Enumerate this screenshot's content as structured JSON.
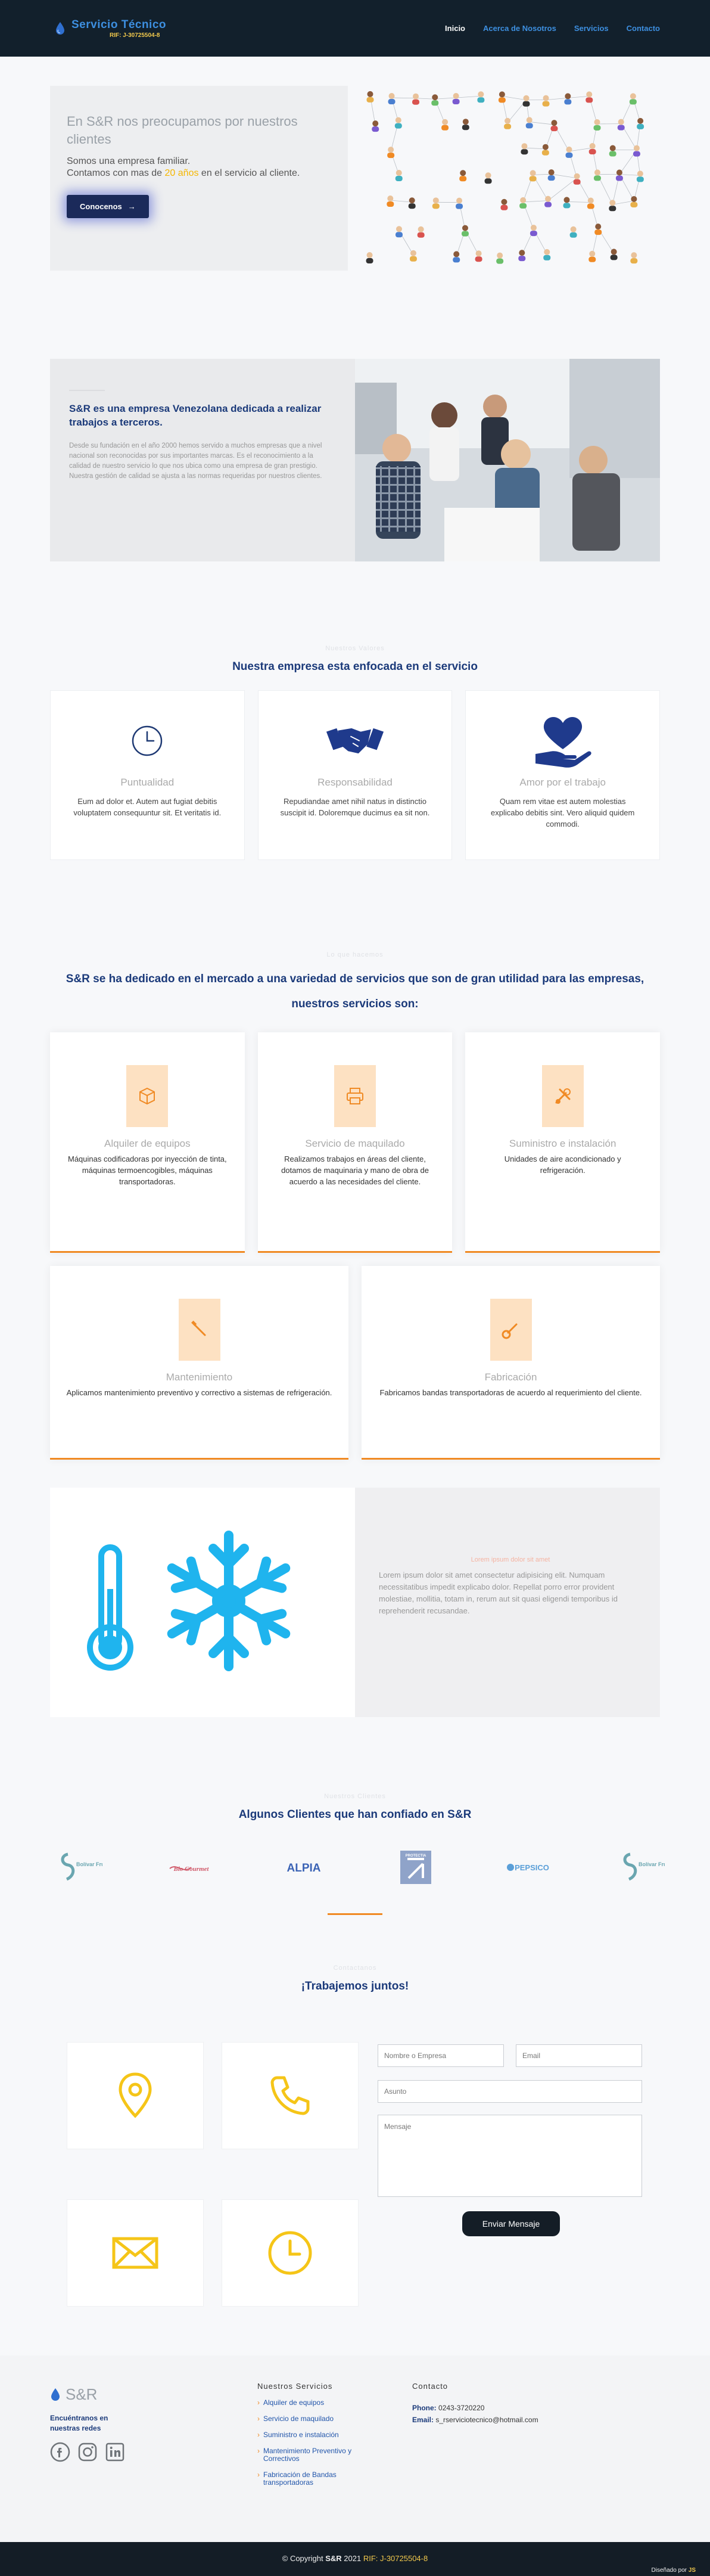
{
  "header": {
    "brand": "Servicio Técnico",
    "rif": "RIF: J-30725504-8",
    "nav": [
      "Inicio",
      "Acerca de Nosotros",
      "Servicios",
      "Contacto"
    ]
  },
  "hero": {
    "title": "En S&R nos preocupamos por nuestros clientes",
    "text_1": "Somos una empresa familiar.",
    "text_2": "Contamos con mas de",
    "highlight": "20 años",
    "text_3": "en el servicio al cliente.",
    "button": "Conocenos"
  },
  "about": {
    "title": "S&R es una empresa Venezolana dedicada a realizar trabajos a terceros.",
    "text": "Desde su fundación en el año 2000 hemos servido a muchos empresas que a nivel nacional son reconocidas por sus importantes marcas. Es el reconocimiento a la calidad de nuestro servicio lo que nos ubica como una empresa de gran prestigio. Nuestra gestión de calidad se ajusta a las normas requeridas por nuestros clientes."
  },
  "values": {
    "label": "Nuestros Valores",
    "title": "Nuestra empresa esta enfocada en el servicio",
    "cards": [
      {
        "title": "Puntualidad",
        "text": "Eum ad dolor et. Autem aut fugiat debitis voluptatem consequuntur sit. Et veritatis id."
      },
      {
        "title": "Responsabilidad",
        "text": "Repudiandae amet nihil natus in distinctio suscipit id. Doloremque ducimus ea sit non."
      },
      {
        "title": "Amor por el trabajo",
        "text": "Quam rem vitae est autem molestias explicabo debitis sint. Vero aliquid quidem commodi."
      }
    ]
  },
  "services": {
    "label": "Lo que hacemos",
    "title": "S&R se ha dedicado en el mercado a una variedad de servicios que son de gran utilidad para las empresas, nuestros servicios son:",
    "cards": [
      {
        "title": "Alquiler de equipos",
        "text": "Máquinas codificadoras por inyección de tinta, máquinas termoencogibles, máquinas transportadoras."
      },
      {
        "title": "Servicio de maquilado",
        "text": "Realizamos trabajos en áreas del cliente, dotamos de maquinaria y mano de obra de acuerdo a las necesidades del cliente."
      },
      {
        "title": "Suministro e instalación",
        "text": "Unidades de aire acondicionado y refrigeración."
      },
      {
        "title": "Mantenimiento",
        "text": "Aplicamos mantenimiento preventivo y correctivo a sistemas de refrigeración."
      },
      {
        "title": "Fabricación",
        "text": "Fabricamos bandas transportadoras de acuerdo al requerimiento del cliente."
      }
    ]
  },
  "refrigeration": {
    "label": "Lorem ipsum dolor sit amet",
    "text": "Lorem ipsum dolor sit amet consectetur adipisicing elit. Numquam necessitatibus impedit explicabo dolor. Repellat porro error provident molestiae, mollitia, totam in, rerum aut sit quasi eligendi temporibus id reprehenderit recusandae."
  },
  "clients": {
    "label": "Nuestros Clientes",
    "title": "Algunos Clientes que han confiado en S&R",
    "logos": [
      {
        "name": "Bolívar Frutas",
        "color": "#6aa6b0"
      },
      {
        "name": "Bio Gourmet",
        "color": "#d05a6a"
      },
      {
        "name": "ALPIA",
        "color": "#3b63b5"
      },
      {
        "name": "PROTECTIA",
        "color": "#8fa3c9"
      },
      {
        "name": "PEPSICO",
        "color": "#5a9fd8"
      },
      {
        "name": "Bolívar Frutas",
        "color": "#6aa6b0"
      }
    ]
  },
  "contact": {
    "label": "Contactanos",
    "title": "¡Trabajemos juntos!",
    "placeholders": {
      "name": "Nombre o Empresa",
      "email": "Email",
      "subject": "Asunto",
      "message": "Mensaje"
    },
    "submit": "Enviar Mensaje"
  },
  "footer": {
    "brand": "S&R",
    "social_text": "Encuéntranos en nuestras redes",
    "services_head": "Nuestros Servicios",
    "services": [
      "Alquiler de equipos",
      "Servicio de maquilado",
      "Suministro e instalación",
      "Mantenimiento Preventivo y Correctivos",
      "Fabricación de Bandas transportadoras"
    ],
    "contact_head": "Contacto",
    "phone_label": "Phone:",
    "phone": "0243-3720220",
    "email_label": "Email:",
    "email": "s_rserviciotecnico@hotmail.com",
    "copyright_prefix": "© Copyright",
    "copyright_brand": "S&R",
    "copyright_year": "2021",
    "copyright_rif": "RIF: J-30725504-8",
    "designed_by": "Diseñado por",
    "designer": "JS"
  }
}
